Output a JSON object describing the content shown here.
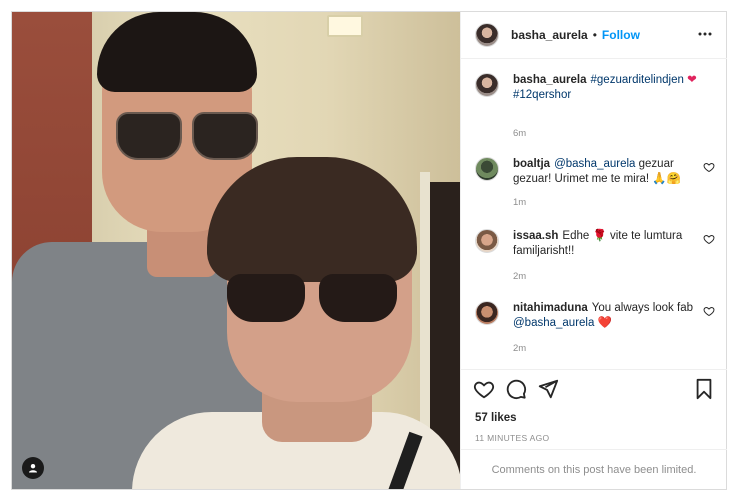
{
  "post": {
    "username": "basha_aurela",
    "separator": "•",
    "follow_label": "Follow",
    "caption_username": "basha_aurela",
    "caption_text": "#gezuarditelindjen",
    "caption_text2": "#12qershor",
    "caption_time": "6m",
    "likes": "57 likes",
    "timestamp": "11 MINUTES AGO",
    "comments_limited": "Comments on this post have been limited."
  },
  "comments": [
    {
      "username": "boaltja",
      "mention": "@basha_aurela",
      "text": "gezuar gezuar! Urimet me te mira!",
      "emoji": "🙏🤗",
      "time": "1m"
    },
    {
      "username": "issaa.sh",
      "text_before": "Edhe",
      "emoji": "🌹",
      "text": "vite te lumtura familjarisht!!",
      "time": "2m"
    },
    {
      "username": "nitahimaduna",
      "text": "You always look fab",
      "mention": "@basha_aurela",
      "emoji": "❤️",
      "time": "2m"
    }
  ],
  "icons": {
    "more": "more-options-icon",
    "like": "heart-icon",
    "comment": "comment-icon",
    "share": "share-icon",
    "save": "bookmark-icon",
    "tag": "user-tag-icon"
  },
  "colors": {
    "link": "#0095f6",
    "heart": "#ed4956",
    "muted": "#8e8e8e"
  }
}
